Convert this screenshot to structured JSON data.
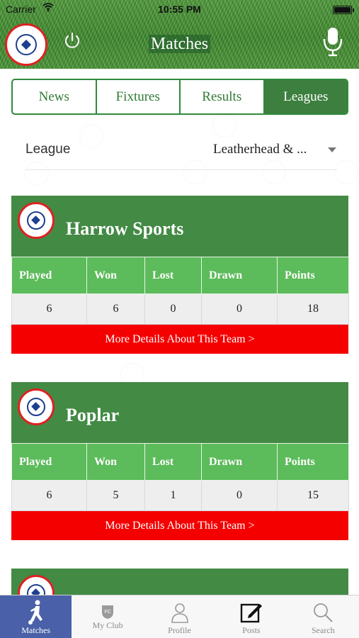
{
  "status_bar": {
    "carrier": "Carrier",
    "time": "10:55 PM"
  },
  "header": {
    "title": "Matches"
  },
  "segments": [
    {
      "label": "News",
      "active": false
    },
    {
      "label": "Fixtures",
      "active": false
    },
    {
      "label": "Results",
      "active": false
    },
    {
      "label": "Leagues",
      "active": true
    }
  ],
  "league": {
    "label": "League",
    "value": "Leatherhead & ..."
  },
  "table_headers": [
    "Played",
    "Won",
    "Lost",
    "Drawn",
    "Points"
  ],
  "teams": [
    {
      "name": "Harrow Sports",
      "played": "6",
      "won": "6",
      "lost": "0",
      "drawn": "0",
      "points": "18",
      "details": "More Details About This Team >"
    },
    {
      "name": "Poplar",
      "played": "6",
      "won": "5",
      "lost": "1",
      "drawn": "0",
      "points": "15",
      "details": "More Details About This Team >"
    }
  ],
  "tabs": [
    {
      "label": "Matches",
      "icon": "football-player-icon",
      "active": true
    },
    {
      "label": "My Club",
      "icon": "club-badge-icon",
      "active": false
    },
    {
      "label": "Profile",
      "icon": "person-icon",
      "active": false
    },
    {
      "label": "Posts",
      "icon": "edit-icon",
      "active": false
    },
    {
      "label": "Search",
      "icon": "search-icon",
      "active": false
    }
  ],
  "colors": {
    "header_green": "#438a45",
    "stat_header_green": "#5cbb5a",
    "details_red": "#f40000",
    "active_tab": "#4a60a8"
  }
}
